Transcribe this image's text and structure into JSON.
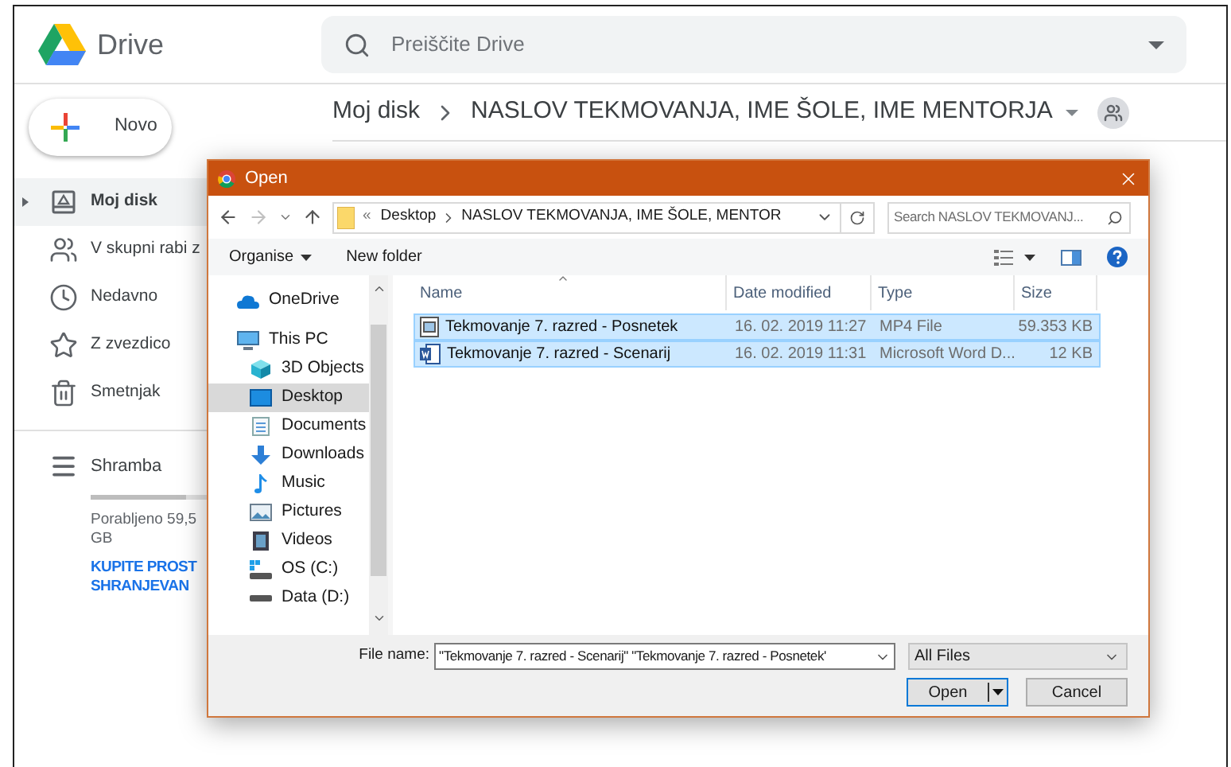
{
  "drive": {
    "app_name": "Drive",
    "search": {
      "placeholder": "Preiščite Drive"
    },
    "new_button": "Novo",
    "breadcrumb": [
      {
        "label": "Moj disk"
      },
      {
        "label": "NASLOV TEKMOVANJA, IME ŠOLE, IME MENTORJA"
      }
    ],
    "sidebar": {
      "items": [
        {
          "label": "Moj disk",
          "selected": true
        },
        {
          "label": "V skupni rabi z",
          "selected": false
        },
        {
          "label": "Nedavno",
          "selected": false
        },
        {
          "label": "Z zvezdico",
          "selected": false
        },
        {
          "label": "Smetnjak",
          "selected": false
        }
      ],
      "storage": {
        "label": "Shramba",
        "usage": "Porabljeno 59,5",
        "usage_line_2": "GB",
        "level": 0.6,
        "link_line_1": "KUPITE PROST",
        "link_line_2": "SHRANJEVAN"
      }
    }
  },
  "dialog": {
    "title": "Open",
    "address": {
      "overflow": "«",
      "path": [
        {
          "label": "Desktop"
        },
        {
          "label": "NASLOV TEKMOVANJA, IME ŠOLE, MENTOR"
        }
      ]
    },
    "search": {
      "placeholder": "Search NASLOV TEKMOVANJ..."
    },
    "toolbar": [
      "Organise",
      "New folder"
    ],
    "nav": [
      {
        "label": "OneDrive",
        "kind": "cloud",
        "selected": false
      },
      {
        "label": "This PC",
        "kind": "pc",
        "selected": false,
        "children": [
          {
            "label": "3D Objects",
            "kind": "cube",
            "selected": false
          },
          {
            "label": "Desktop",
            "kind": "desktop",
            "selected": true
          },
          {
            "label": "Documents",
            "kind": "document",
            "selected": false
          },
          {
            "label": "Downloads",
            "kind": "download",
            "selected": false
          },
          {
            "label": "Music",
            "kind": "music",
            "selected": false
          },
          {
            "label": "Pictures",
            "kind": "picture",
            "selected": false
          },
          {
            "label": "Videos",
            "kind": "video",
            "selected": false
          },
          {
            "label": "OS (C:)",
            "kind": "osdrive",
            "selected": false
          },
          {
            "label": "Data (D:)",
            "kind": "drive",
            "selected": false
          }
        ]
      }
    ],
    "table": {
      "columns": [
        "Name",
        "Date modified",
        "Type",
        "Size"
      ],
      "rows": [
        {
          "name": "Tekmovanje 7. razred - Posnetek",
          "kind": "video",
          "date": "16. 02. 2019 11:27",
          "type": "MP4 File",
          "size": "59.353 KB",
          "selected": true
        },
        {
          "name": "Tekmovanje 7. razred - Scenarij",
          "kind": "word",
          "date": "16. 02. 2019 11:31",
          "type": "Microsoft Word D...",
          "size": "12 KB",
          "selected": true
        }
      ]
    },
    "file_name": {
      "label": "File name:",
      "value": "\"Tekmovanje 7. razred - Scenarij\" \"Tekmovanje 7. razred - Posnetek'"
    },
    "file_type": "All Files",
    "buttons": {
      "open": "Open",
      "cancel": "Cancel"
    }
  }
}
